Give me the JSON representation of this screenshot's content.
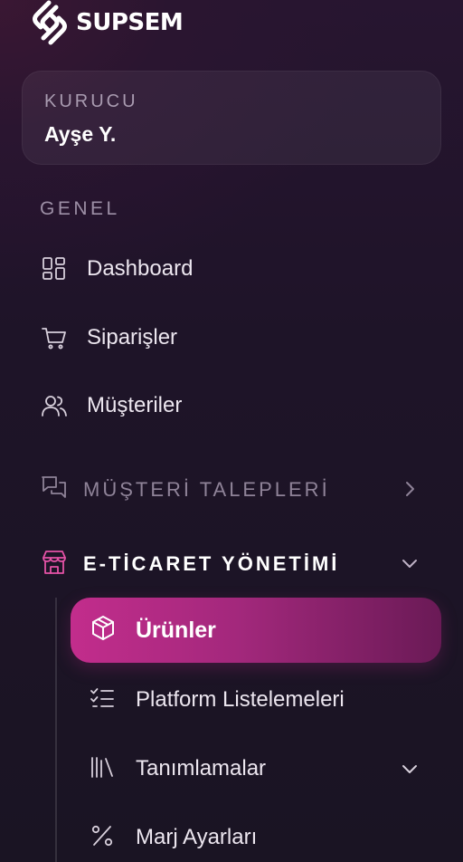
{
  "brand": {
    "name": "SUPSEM",
    "accent": "#e452a6"
  },
  "user": {
    "role": "KURUCU",
    "name": "Ayşe Y."
  },
  "sections": {
    "general": "GENEL"
  },
  "nav": {
    "dashboard": {
      "label": "Dashboard",
      "icon": "layout-grid-icon"
    },
    "orders": {
      "label": "Siparişler",
      "icon": "shopping-cart-icon"
    },
    "customers": {
      "label": "Müşteriler",
      "icon": "users-icon"
    }
  },
  "groups": {
    "customer_requests": {
      "label": "MÜŞTERİ TALEPLERİ",
      "icon": "messages-icon",
      "state": "collapsed"
    },
    "ecommerce": {
      "label": "E-TİCARET YÖNETİMİ",
      "icon": "store-icon",
      "state": "expanded"
    }
  },
  "ecommerce_items": {
    "products": {
      "label": "Ürünler",
      "icon": "package-icon",
      "active": true
    },
    "platform_listings": {
      "label": "Platform Listelemeleri",
      "icon": "list-checks-icon"
    },
    "definitions": {
      "label": "Tanımlamalar",
      "icon": "library-icon",
      "state": "collapsed"
    },
    "margin_settings": {
      "label": "Marj Ayarları",
      "icon": "percent-icon"
    }
  }
}
